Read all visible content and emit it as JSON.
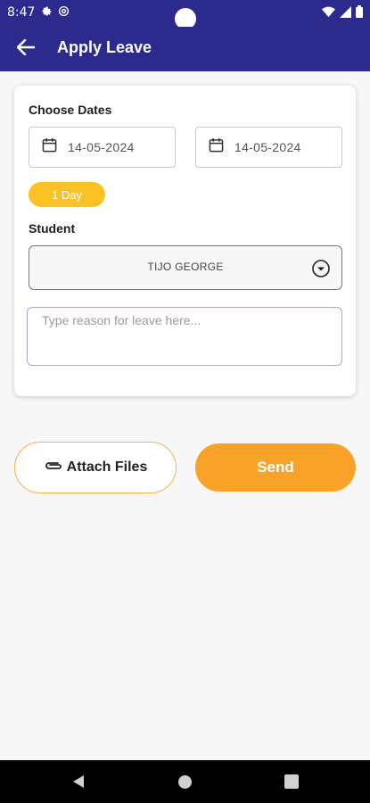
{
  "status_bar": {
    "time": "8:47",
    "icons": [
      "gear-icon",
      "at-sign-icon",
      "wifi-icon",
      "signal-icon",
      "battery-icon"
    ]
  },
  "app_bar": {
    "title": "Apply Leave",
    "back_icon": "arrow-left-icon",
    "background": "#2d2a8e"
  },
  "form": {
    "dates_label": "Choose Dates",
    "from_date": "14-05-2024",
    "to_date": "14-05-2024",
    "calendar_icon": "calendar-icon",
    "days_badge": "1 Day",
    "student_label": "Student",
    "student_value": "TIJO GEORGE",
    "reason_placeholder": "Type reason for leave here...",
    "reason_value": ""
  },
  "actions": {
    "attach_label": "Attach Files",
    "attach_icon": "paperclip-icon",
    "send_label": "Send"
  },
  "colors": {
    "primary": "#2d2a8e",
    "badge": "#fbc226",
    "send": "#f8a328",
    "attach_border": "#f5b34b"
  },
  "nav_bar": {
    "icons": [
      "nav-back-icon",
      "nav-home-icon",
      "nav-recents-icon"
    ]
  }
}
